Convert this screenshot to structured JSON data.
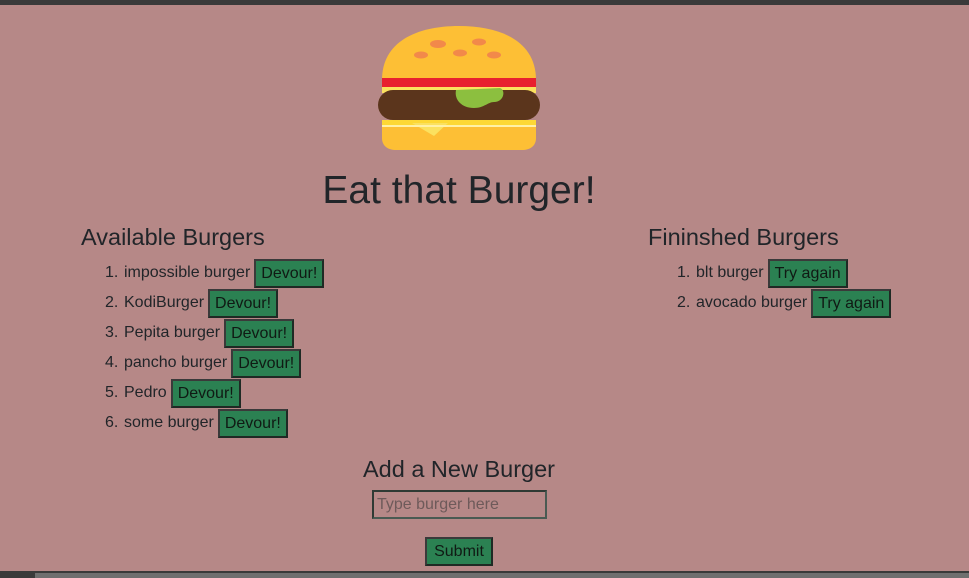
{
  "header": {
    "title": "Eat that Burger!",
    "logo_icon": "burger-icon"
  },
  "available": {
    "title": "Available Burgers",
    "button_label": "Devour!",
    "items": [
      {
        "num": "1.",
        "name": "impossible burger"
      },
      {
        "num": "2.",
        "name": "KodiBurger"
      },
      {
        "num": "3.",
        "name": "Pepita burger"
      },
      {
        "num": "4.",
        "name": "pancho burger"
      },
      {
        "num": "5.",
        "name": "Pedro"
      },
      {
        "num": "6.",
        "name": "some burger"
      }
    ]
  },
  "finished": {
    "title": "Fininshed Burgers",
    "button_label": "Try again",
    "items": [
      {
        "num": "1.",
        "name": "blt burger"
      },
      {
        "num": "2.",
        "name": "avocado burger"
      }
    ]
  },
  "add_form": {
    "title": "Add a New Burger",
    "input_value": "",
    "input_placeholder": "Type burger here",
    "submit_label": "Submit"
  },
  "colors": {
    "background": "#b68887",
    "button": "#2b8152",
    "text": "#212529"
  }
}
